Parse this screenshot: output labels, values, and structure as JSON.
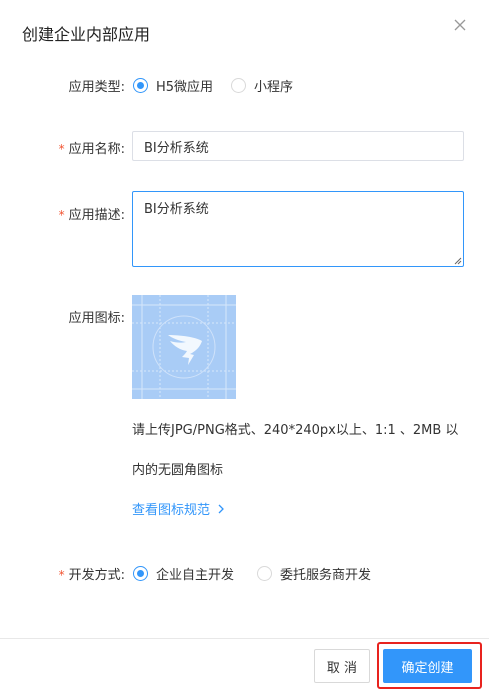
{
  "dialog": {
    "title": "创建企业内部应用",
    "close_icon": "close-icon"
  },
  "form": {
    "app_type": {
      "label": "应用类型:",
      "options": [
        {
          "label": "H5微应用",
          "checked": true
        },
        {
          "label": "小程序",
          "checked": false
        }
      ]
    },
    "app_name": {
      "label": "应用名称:",
      "required": true,
      "value": "BI分析系统"
    },
    "app_desc": {
      "label": "应用描述:",
      "required": true,
      "value": "BI分析系统"
    },
    "app_icon": {
      "label": "应用图标:",
      "icon": "dingtalk-logo-icon",
      "hint_line1": "请上传JPG/PNG格式、240*240px以上、1:1 、2MB 以",
      "hint_line2": "内的无圆角图标",
      "spec_link": "查看图标规范",
      "spec_link_icon": "chevron-right-icon"
    },
    "dev_mode": {
      "label": "开发方式:",
      "required": true,
      "options": [
        {
          "label": "企业自主开发",
          "checked": true
        },
        {
          "label": "委托服务商开发",
          "checked": false
        }
      ]
    },
    "required_mark": "*"
  },
  "footer": {
    "cancel_label": "取 消",
    "confirm_label": "确定创建"
  },
  "colors": {
    "accent": "#3296fa",
    "required": "#f15533",
    "highlight": "#e8231e",
    "icon_bg": "#a9ccf6"
  }
}
